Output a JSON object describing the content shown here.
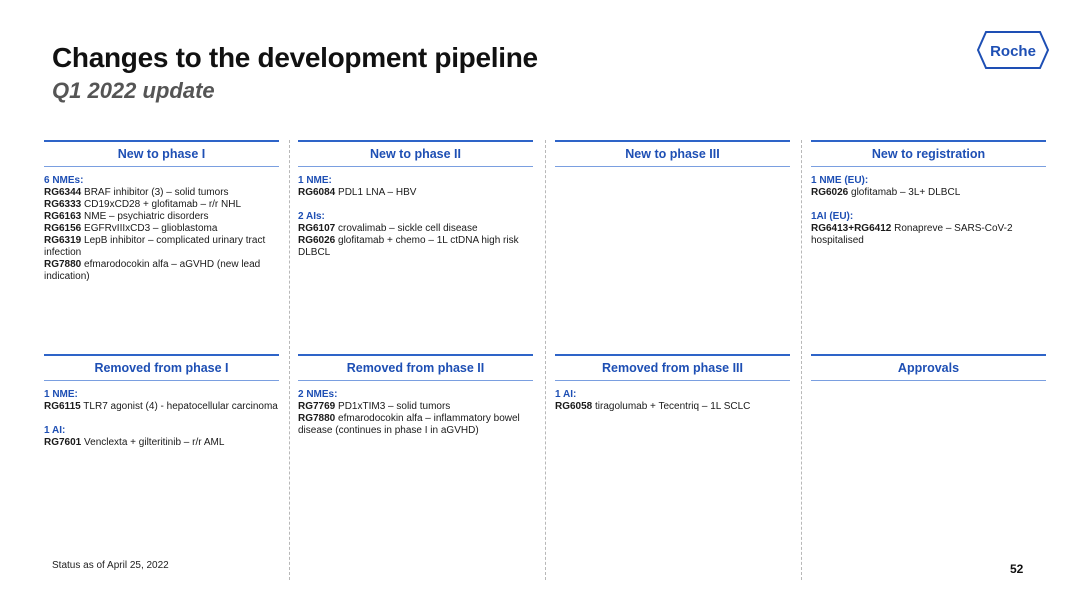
{
  "title": "Changes to the development pipeline",
  "subtitle": "Q1 2022 update",
  "logo": {
    "text": "Roche",
    "color": "#1e4fb4"
  },
  "accent_color": "#1e4fb4",
  "sections": {
    "new_phase1": {
      "header": "New to phase I",
      "groups": [
        {
          "label": "6 NMEs:",
          "items": [
            {
              "code": "RG6344",
              "text": " BRAF inhibitor (3) – solid tumors"
            },
            {
              "code": "RG6333",
              "text": " CD19xCD28 + glofitamab – r/r NHL"
            },
            {
              "code": "RG6163",
              "text": " NME – psychiatric disorders"
            },
            {
              "code": "RG6156",
              "text": " EGFRvIIIxCD3 – glioblastoma"
            },
            {
              "code": "RG6319",
              "text": " LepB inhibitor – complicated urinary tract infection"
            },
            {
              "code": "RG7880",
              "text": " efmarodocokin alfa – aGVHD (new lead indication)"
            }
          ]
        }
      ]
    },
    "new_phase2": {
      "header": "New to phase II",
      "groups": [
        {
          "label": "1 NME:",
          "items": [
            {
              "code": "RG6084",
              "text": " PDL1 LNA – HBV"
            }
          ]
        },
        {
          "label": "2 AIs:",
          "items": [
            {
              "code": "RG6107",
              "text": " crovalimab – sickle cell disease"
            },
            {
              "code": "RG6026",
              "text": " glofitamab + chemo – 1L ctDNA high risk DLBCL"
            }
          ]
        }
      ]
    },
    "new_phase3": {
      "header": "New to phase III",
      "groups": []
    },
    "new_registration": {
      "header": "New to registration",
      "groups": [
        {
          "label": "1 NME (EU):",
          "items": [
            {
              "code": "RG6026",
              "text": " glofitamab – 3L+ DLBCL"
            }
          ]
        },
        {
          "label": "1AI (EU):",
          "items": [
            {
              "code": "RG6413+RG6412",
              "text": " Ronapreve – SARS-CoV-2 hospitalised"
            }
          ]
        }
      ]
    },
    "removed_phase1": {
      "header": "Removed from phase I",
      "groups": [
        {
          "label": "1 NME:",
          "items": [
            {
              "code": "RG6115",
              "text": " TLR7 agonist (4) - hepatocellular carcinoma"
            }
          ]
        },
        {
          "label": "1 AI:",
          "items": [
            {
              "code": "RG7601",
              "text": " Venclexta + gilteritinib – r/r AML"
            }
          ]
        }
      ]
    },
    "removed_phase2": {
      "header": "Removed from phase II",
      "groups": [
        {
          "label": "2 NMEs:",
          "items": [
            {
              "code": "RG7769",
              "text": " PD1xTIM3 – solid tumors"
            },
            {
              "code": "RG7880",
              "text": " efmarodocokin alfa – inflammatory bowel disease (continues in phase I in aGVHD)"
            }
          ]
        }
      ]
    },
    "removed_phase3": {
      "header": "Removed from phase III",
      "groups": [
        {
          "label": "1 AI:",
          "items": [
            {
              "code": "RG6058",
              "text": " tiragolumab + Tecentriq – 1L SCLC"
            }
          ]
        }
      ]
    },
    "approvals": {
      "header": "Approvals",
      "groups": []
    }
  },
  "footer": {
    "status": "Status as of April 25, 2022",
    "page_number": "52"
  }
}
